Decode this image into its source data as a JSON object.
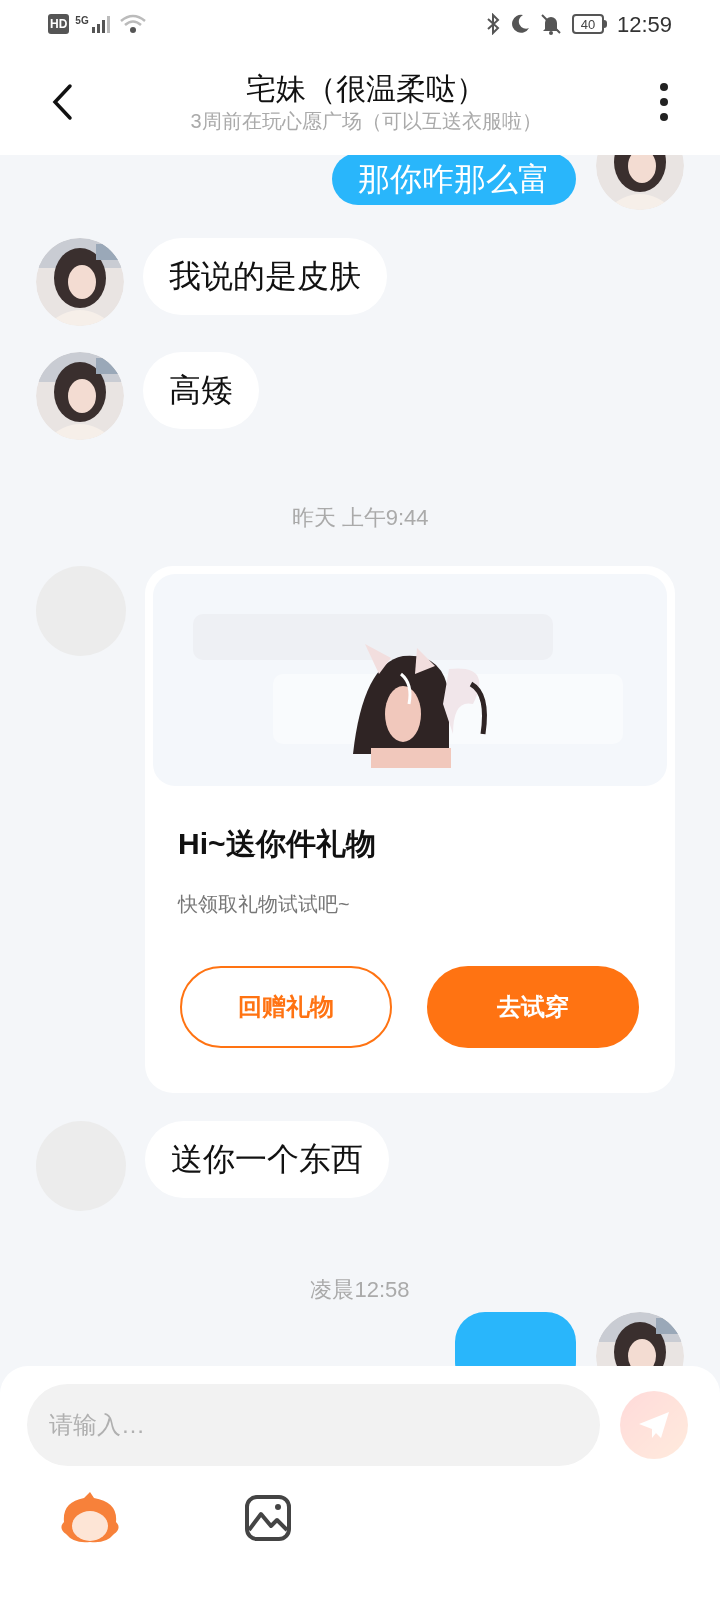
{
  "status_bar": {
    "hd": "HD",
    "network": "5G",
    "battery": "40",
    "time": "12:59"
  },
  "header": {
    "title": "宅妹（很温柔哒）",
    "subtitle": "3周前在玩心愿广场（可以互送衣服啦）"
  },
  "messages": [
    {
      "kind": "text",
      "outgoing": true,
      "avatar_loaded": true,
      "text": "那你咋那么富"
    },
    {
      "kind": "text",
      "outgoing": false,
      "avatar_loaded": true,
      "text": "我说的是皮肤"
    },
    {
      "kind": "text",
      "outgoing": false,
      "avatar_loaded": true,
      "text": "高矮"
    },
    {
      "kind": "timestamp",
      "text": "昨天 上午9:44"
    },
    {
      "kind": "gift",
      "outgoing": false,
      "avatar_loaded": false,
      "title": "Hi~送你件礼物",
      "subtitle": "快领取礼物试试吧~",
      "buttons": [
        {
          "kind": "outline",
          "label": "回赠礼物"
        },
        {
          "kind": "filled",
          "label": "去试穿"
        }
      ]
    },
    {
      "kind": "text",
      "outgoing": false,
      "avatar_loaded": false,
      "text": "送你一个东西"
    },
    {
      "kind": "timestamp",
      "text": "凌晨12:58"
    },
    {
      "kind": "cut_off",
      "outgoing": true,
      "avatar_loaded": true
    }
  ],
  "composer": {
    "placeholder": "请输入…",
    "send_disabled": true
  }
}
